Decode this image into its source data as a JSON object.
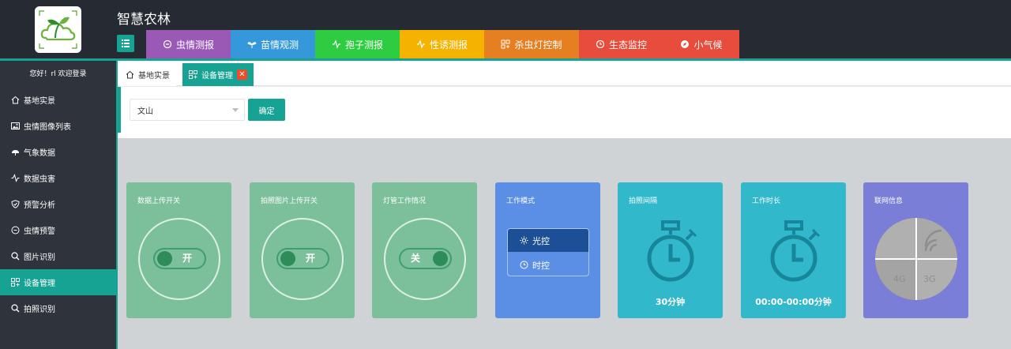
{
  "header": {
    "app_title": "智慧农林",
    "logo_icon": "seedling-cloud-icon",
    "menu_toggle_icon": "menu-list-icon",
    "nav_tabs": [
      {
        "label": "虫情测报",
        "icon": "cycle-icon",
        "color": "#9b59b6"
      },
      {
        "label": "苗情观测",
        "icon": "seedling-icon",
        "color": "#3498db"
      },
      {
        "label": "孢子测报",
        "icon": "pulse-icon",
        "color": "#2ecc40"
      },
      {
        "label": "性诱测报",
        "icon": "pulse-icon",
        "color": "#f5b300"
      },
      {
        "label": "杀虫灯控制",
        "icon": "device-grid-icon",
        "color": "#e67e22"
      },
      {
        "label": "生态监控",
        "icon": "clock-icon",
        "color": "#e74c3c"
      },
      {
        "label": "小气候",
        "icon": "compass-icon",
        "color": "#e74c3c"
      }
    ]
  },
  "sidebar": {
    "greeting": "您好！rl 欢迎登录",
    "items": [
      {
        "label": "基地实景",
        "icon": "home-icon",
        "active": false
      },
      {
        "label": "虫情图像列表",
        "icon": "image-icon",
        "active": false
      },
      {
        "label": "气象数据",
        "icon": "weather-icon",
        "active": false
      },
      {
        "label": "数据虫害",
        "icon": "pulse-icon",
        "active": false
      },
      {
        "label": "预警分析",
        "icon": "shield-icon",
        "active": false
      },
      {
        "label": "虫情预警",
        "icon": "cycle-icon",
        "active": false
      },
      {
        "label": "图片识别",
        "icon": "search-icon",
        "active": false
      },
      {
        "label": "设备管理",
        "icon": "device-grid-icon",
        "active": true
      },
      {
        "label": "拍照识别",
        "icon": "search-icon",
        "active": false
      }
    ]
  },
  "content_tabs": {
    "home": {
      "label": "基地实景",
      "icon": "home-icon"
    },
    "device": {
      "label": "设备管理",
      "icon": "device-grid-icon",
      "close": "✕"
    }
  },
  "filter": {
    "region_value": "文山",
    "confirm_label": "确定"
  },
  "cards": {
    "data_upload": {
      "title": "数据上传开关",
      "state": "开",
      "color": "#7bbf9b"
    },
    "photo_upload": {
      "title": "拍照图片上传开关",
      "state": "开",
      "color": "#7bbf9b"
    },
    "lamp_status": {
      "title": "灯管工作情况",
      "state": "关",
      "color": "#7bbf9b"
    },
    "work_mode": {
      "title": "工作模式",
      "selected": "光控",
      "other": "时控",
      "color": "#5b8fe6"
    },
    "photo_interval": {
      "title": "拍照间隔",
      "value": "30分钟",
      "color": "#31b9cb"
    },
    "work_duration": {
      "title": "工作时长",
      "value": "00:00-00:00分钟",
      "color": "#31b9cb"
    },
    "network_info": {
      "title": "联网信息",
      "labels": [
        "4G",
        "3G"
      ],
      "color": "#7a7ed6"
    }
  }
}
